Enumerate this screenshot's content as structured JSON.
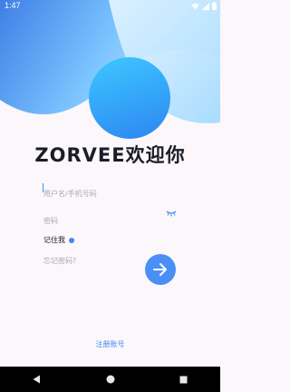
{
  "status_bar": {
    "time": "1:47"
  },
  "login": {
    "title": "ZORVEE欢迎你",
    "username_placeholder": "用户名/手机号码",
    "password_placeholder": "密码",
    "remember_label": "记住我",
    "forgot_label": "忘记密码?",
    "register_label": "注册账号"
  },
  "colors": {
    "accent": "#3d8cf0",
    "gradient_light": "#9fd9ff",
    "gradient_dark": "#3f7fe6",
    "circle": "#2ea4f7",
    "background": "#fbf7fb",
    "title": "#1a1d29"
  },
  "icons": {
    "password_toggle": "closed-eye-icon",
    "submit": "arrow-right-icon",
    "nav_back": "back-triangle-icon",
    "nav_home": "home-circle-icon",
    "nav_recents": "recents-square-icon"
  }
}
